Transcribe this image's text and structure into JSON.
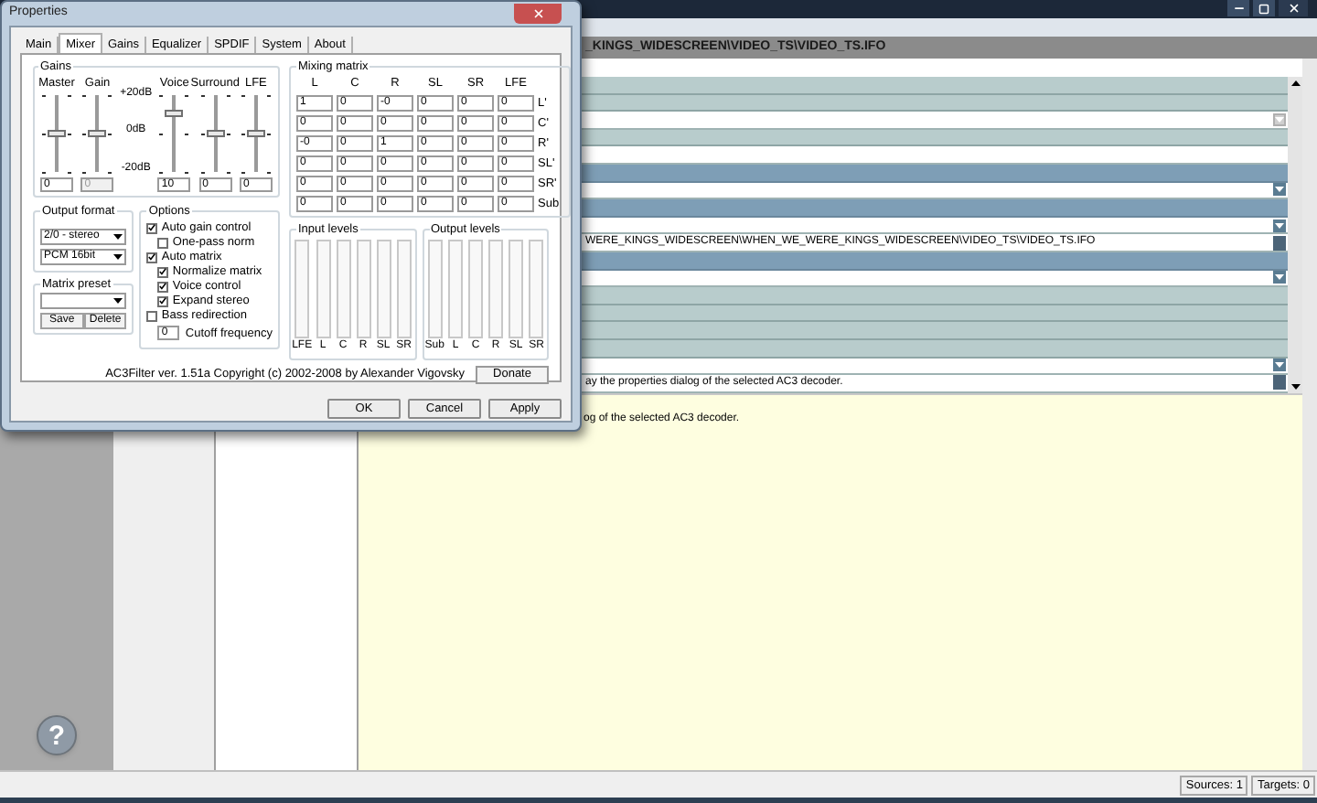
{
  "app": {
    "path": "_KINGS_WIDESCREEN\\VIDEO_TS\\VIDEO_TS.IFO",
    "rows": [
      {
        "kind": "header"
      },
      {
        "kind": "header"
      },
      {
        "kind": "dropdown",
        "disabled": true
      },
      {
        "kind": "header"
      },
      {
        "kind": "field"
      },
      {
        "kind": "section"
      },
      {
        "kind": "dropdown",
        "disabled": false
      },
      {
        "kind": "section"
      },
      {
        "kind": "dropdown",
        "disabled": false
      },
      {
        "kind": "text",
        "text": "WERE_KINGS_WIDESCREEN\\WHEN_WE_WERE_KINGS_WIDESCREEN\\VIDEO_TS\\VIDEO_TS.IFO"
      },
      {
        "kind": "section"
      },
      {
        "kind": "dropdown",
        "disabled": false
      },
      {
        "kind": "header"
      },
      {
        "kind": "header"
      },
      {
        "kind": "header"
      },
      {
        "kind": "header"
      },
      {
        "kind": "dropdown",
        "disabled": false
      },
      {
        "kind": "text",
        "text": "ay the properties dialog of the selected AC3 decoder."
      }
    ],
    "description": "og of the selected AC3 decoder.",
    "help_button": "?",
    "status_bar": [
      "Sources: 1",
      "Targets: 0"
    ]
  },
  "dialog": {
    "title": "Properties",
    "tabs": [
      {
        "label": "Main",
        "selected": false
      },
      {
        "label": "Mixer",
        "selected": true
      },
      {
        "label": "Gains",
        "selected": false
      },
      {
        "label": "Equalizer",
        "selected": false
      },
      {
        "label": "SPDIF",
        "selected": false
      },
      {
        "label": "System",
        "selected": false
      },
      {
        "label": "About",
        "selected": false
      }
    ],
    "gains": {
      "title": "Gains",
      "scale": [
        "+20dB",
        "0dB",
        "-20dB"
      ],
      "sliders_left": [
        {
          "label": "Master",
          "level": 0.5,
          "value": "0",
          "disabled": false
        },
        {
          "label": "Gain",
          "level": 0.5,
          "value": "0",
          "disabled": true
        }
      ],
      "sliders_right": [
        {
          "label": "Voice",
          "level": 0.75,
          "value": "10",
          "disabled": false
        },
        {
          "label": "Surround",
          "level": 0.5,
          "value": "0",
          "disabled": false
        },
        {
          "label": "LFE",
          "level": 0.5,
          "value": "0",
          "disabled": false
        }
      ]
    },
    "mixing_matrix": {
      "title": "Mixing matrix",
      "columns": [
        "L",
        "C",
        "R",
        "SL",
        "SR",
        "LFE"
      ],
      "rows": [
        {
          "label": "L'",
          "values": [
            "1",
            "0",
            "-0",
            "0",
            "0",
            "0"
          ]
        },
        {
          "label": "C'",
          "values": [
            "0",
            "0",
            "0",
            "0",
            "0",
            "0"
          ]
        },
        {
          "label": "R'",
          "values": [
            "-0",
            "0",
            "1",
            "0",
            "0",
            "0"
          ]
        },
        {
          "label": "SL'",
          "values": [
            "0",
            "0",
            "0",
            "0",
            "0",
            "0"
          ]
        },
        {
          "label": "SR'",
          "values": [
            "0",
            "0",
            "0",
            "0",
            "0",
            "0"
          ]
        },
        {
          "label": "Sub",
          "values": [
            "0",
            "0",
            "0",
            "0",
            "0",
            "0"
          ]
        }
      ]
    },
    "output_format": {
      "title": "Output format",
      "selects": [
        "2/0 - stereo",
        "PCM 16bit"
      ]
    },
    "matrix_preset": {
      "title": "Matrix preset",
      "buttons": [
        "Save",
        "Delete"
      ]
    },
    "options": {
      "title": "Options",
      "items": [
        {
          "label": "Auto gain control",
          "checked": true,
          "children": [
            {
              "label": "One-pass norm",
              "checked": false
            }
          ]
        },
        {
          "label": "Auto matrix",
          "checked": true,
          "children": [
            {
              "label": "Normalize matrix",
              "checked": true
            },
            {
              "label": "Voice control",
              "checked": true
            },
            {
              "label": "Expand stereo",
              "checked": true
            }
          ]
        },
        {
          "label": "Bass redirection",
          "checked": false
        }
      ],
      "cutoff": {
        "value": "0",
        "label": "Cutoff frequency"
      }
    },
    "input_levels": {
      "title": "Input levels",
      "channels": [
        {
          "label": "LFE"
        },
        {
          "label": "L"
        },
        {
          "label": "C"
        },
        {
          "label": "R"
        },
        {
          "label": "SL"
        },
        {
          "label": "SR"
        }
      ]
    },
    "output_levels": {
      "title": "Output levels",
      "channels": [
        {
          "label": "Sub"
        },
        {
          "label": "L"
        },
        {
          "label": "C"
        },
        {
          "label": "R"
        },
        {
          "label": "SL"
        },
        {
          "label": "SR"
        }
      ]
    },
    "footer": "AC3Filter ver. 1.51a Copyright (c) 2002-2008 by Alexander Vigovsky",
    "donate": "Donate",
    "buttons": [
      "OK",
      "Cancel",
      "Apply"
    ]
  }
}
